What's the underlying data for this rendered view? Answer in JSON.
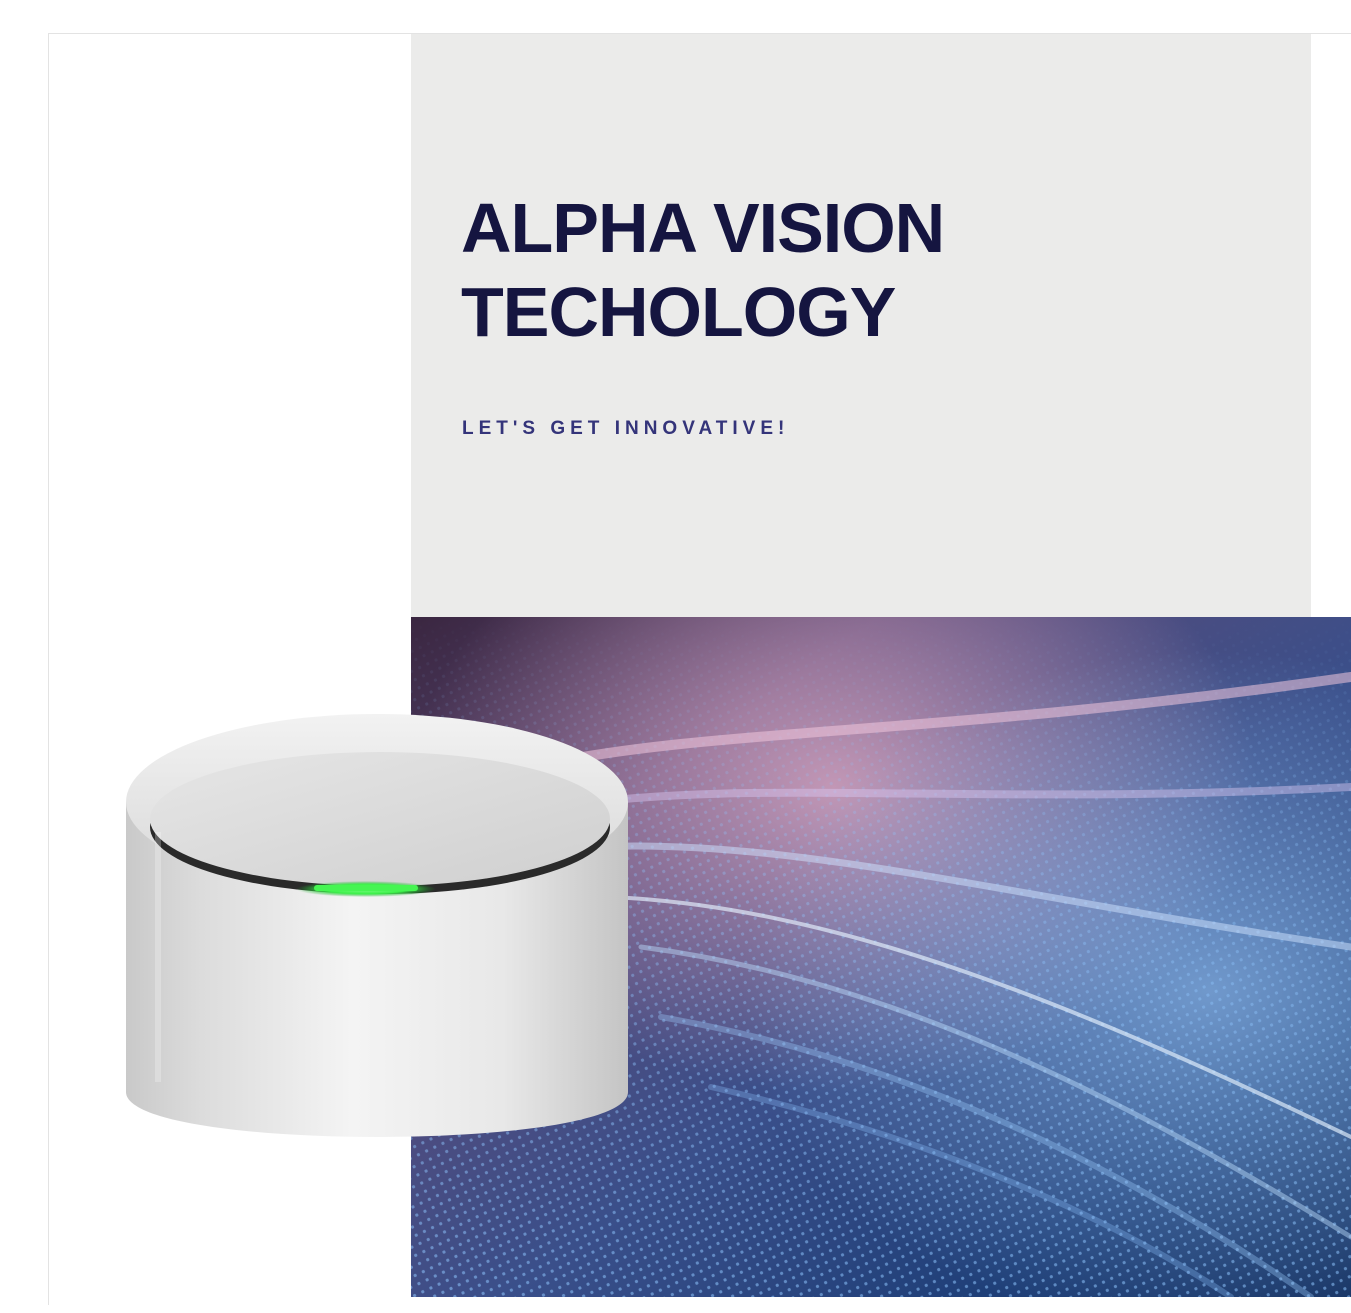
{
  "brand": {
    "title_line_1": "ALPHA VISION",
    "title_line_2": "TECHOLOGY",
    "tagline": "LET'S GET INNOVATIVE!"
  },
  "colors": {
    "title": "#151540",
    "tagline": "#34347a",
    "panel_background": "#ebebea",
    "device_led": "#3df04a"
  },
  "images": {
    "hero": "abstract-digital-wave-particles",
    "device": "round-silver-smart-speaker-with-green-led"
  }
}
